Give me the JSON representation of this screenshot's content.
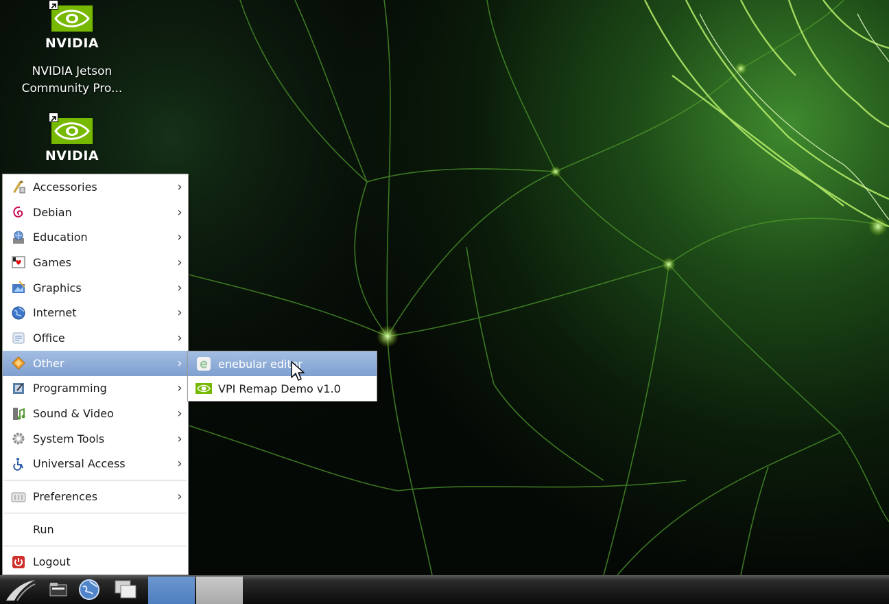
{
  "desktop": {
    "icons": [
      {
        "name": "nvidia-community-projects",
        "logo_text": "NVIDIA",
        "label": "NVIDIA Jetson Community Pro..."
      },
      {
        "name": "nvidia-shortcut-2",
        "logo_text": "NVIDIA",
        "label": ""
      }
    ],
    "accent_color": "#76b900"
  },
  "menu": {
    "items": [
      {
        "label": "Accessories",
        "icon": "accessories-icon",
        "has_submenu": true
      },
      {
        "label": "Debian",
        "icon": "debian-swirl-icon",
        "has_submenu": true
      },
      {
        "label": "Education",
        "icon": "education-globe-icon",
        "has_submenu": true
      },
      {
        "label": "Games",
        "icon": "playing-card-icon",
        "has_submenu": true
      },
      {
        "label": "Graphics",
        "icon": "graphics-icon",
        "has_submenu": true
      },
      {
        "label": "Internet",
        "icon": "globe-icon",
        "has_submenu": true
      },
      {
        "label": "Office",
        "icon": "office-icon",
        "has_submenu": true
      },
      {
        "label": "Other",
        "icon": "other-diamond-icon",
        "has_submenu": true,
        "active": true
      },
      {
        "label": "Programming",
        "icon": "programming-icon",
        "has_submenu": true
      },
      {
        "label": "Sound & Video",
        "icon": "music-note-icon",
        "has_submenu": true
      },
      {
        "label": "System Tools",
        "icon": "gear-icon",
        "has_submenu": true
      },
      {
        "label": "Universal Access",
        "icon": "accessibility-icon",
        "has_submenu": true
      }
    ],
    "preferences": {
      "label": "Preferences",
      "icon": "preferences-icon"
    },
    "run": {
      "label": "Run"
    },
    "logout": {
      "label": "Logout",
      "icon": "power-icon"
    },
    "arrow_glyph": "›",
    "highlight_color": "#8eabd8"
  },
  "submenu": {
    "items": [
      {
        "label": "enebular editor",
        "icon": "enebular-icon",
        "active": true
      },
      {
        "label": "VPI Remap Demo v1.0",
        "icon": "nvidia-logo-icon"
      }
    ]
  },
  "taskbar": {
    "buttons": [
      "start-menu-icon",
      "file-manager-icon",
      "web-browser-icon",
      "show-desktop-icon"
    ],
    "workspaces": 2
  }
}
